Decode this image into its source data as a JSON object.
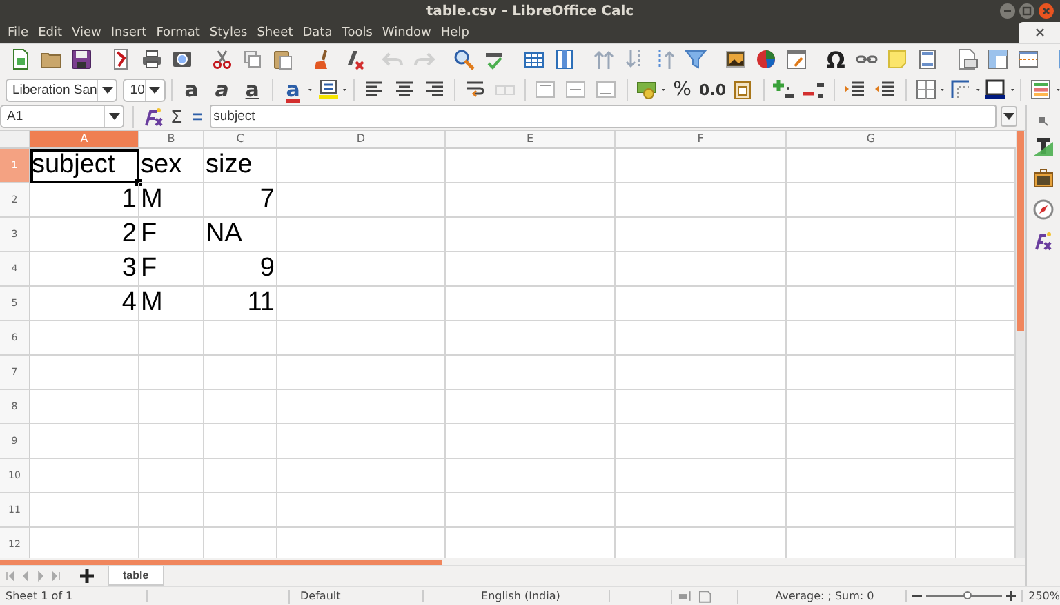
{
  "window": {
    "title": "table.csv - LibreOffice Calc"
  },
  "menu": [
    "File",
    "Edit",
    "View",
    "Insert",
    "Format",
    "Styles",
    "Sheet",
    "Data",
    "Tools",
    "Window",
    "Help"
  ],
  "standard_toolbar": {
    "omega_glyph": "Ω"
  },
  "formatting_toolbar": {
    "font_name": "Liberation San",
    "font_size": "10",
    "bold_glyph": "a",
    "italic_glyph": "a",
    "underline_glyph": "a",
    "font_color_glyph": "a",
    "percent_glyph": "%",
    "decimal_glyph": "0.0"
  },
  "formula_bar": {
    "cell_reference": "A1",
    "sum_glyph": "Σ",
    "equals_glyph": "=",
    "content": "subject"
  },
  "sheet": {
    "columns": [
      {
        "label": "A",
        "selected": true
      },
      {
        "label": "B",
        "selected": false
      },
      {
        "label": "C",
        "selected": false
      },
      {
        "label": "D",
        "selected": false
      },
      {
        "label": "E",
        "selected": false
      },
      {
        "label": "F",
        "selected": false
      },
      {
        "label": "G",
        "selected": false
      }
    ],
    "rows": [
      {
        "label": "1",
        "selected": true,
        "cells": [
          {
            "text": "subject",
            "kind": "text",
            "selected": true
          },
          {
            "text": "sex",
            "kind": "text",
            "selected": false
          },
          {
            "text": "size",
            "kind": "text",
            "selected": false
          }
        ]
      },
      {
        "label": "2",
        "selected": false,
        "cells": [
          {
            "text": "1",
            "kind": "number",
            "selected": false
          },
          {
            "text": "M",
            "kind": "text",
            "selected": false
          },
          {
            "text": "7",
            "kind": "number",
            "selected": false
          }
        ]
      },
      {
        "label": "3",
        "selected": false,
        "cells": [
          {
            "text": "2",
            "kind": "number",
            "selected": false
          },
          {
            "text": "F",
            "kind": "text",
            "selected": false
          },
          {
            "text": "NA",
            "kind": "text",
            "selected": false
          }
        ]
      },
      {
        "label": "4",
        "selected": false,
        "cells": [
          {
            "text": "3",
            "kind": "number",
            "selected": false
          },
          {
            "text": "F",
            "kind": "text",
            "selected": false
          },
          {
            "text": "9",
            "kind": "number",
            "selected": false
          }
        ]
      },
      {
        "label": "5",
        "selected": false,
        "cells": [
          {
            "text": "4",
            "kind": "number",
            "selected": false
          },
          {
            "text": "M",
            "kind": "text",
            "selected": false
          },
          {
            "text": "11",
            "kind": "number",
            "selected": false
          }
        ]
      },
      {
        "label": "6",
        "selected": false
      },
      {
        "label": "7",
        "selected": false
      },
      {
        "label": "8",
        "selected": false
      },
      {
        "label": "9",
        "selected": false
      },
      {
        "label": "10",
        "selected": false
      },
      {
        "label": "11",
        "selected": false
      },
      {
        "label": "12",
        "selected": false
      }
    ]
  },
  "sheet_tabs": [
    {
      "label": "table",
      "selected": true
    }
  ],
  "status_bar": {
    "sheet_position": "Sheet 1 of 1",
    "page_style": "Default",
    "language": "English (India)",
    "selection_summary": "Average: ; Sum: 0",
    "zoom": {
      "level": 0.55,
      "reading": "250%"
    }
  }
}
